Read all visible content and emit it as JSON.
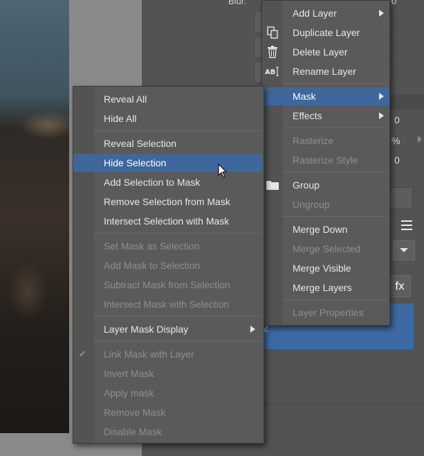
{
  "panel": {
    "blur_label": "Blur:",
    "blur_value": "0",
    "values": [
      "0",
      "%",
      "0"
    ],
    "layer_partial_text": "2",
    "fx_label": "fx"
  },
  "layer_menu": {
    "items": [
      {
        "label": "Add Layer",
        "enabled": true,
        "submenu": true,
        "icon": null
      },
      {
        "label": "Duplicate Layer",
        "enabled": true,
        "submenu": false,
        "icon": "duplicate-icon"
      },
      {
        "label": "Delete Layer",
        "enabled": true,
        "submenu": false,
        "icon": "trash-icon"
      },
      {
        "label": "Rename Layer",
        "enabled": true,
        "submenu": false,
        "icon": "rename-icon"
      },
      {
        "label": "Mask",
        "enabled": true,
        "submenu": true,
        "highlighted": true
      },
      {
        "label": "Effects",
        "enabled": true,
        "submenu": true
      },
      {
        "label": "Rasterize",
        "enabled": false
      },
      {
        "label": "Rasterize Style",
        "enabled": false
      },
      {
        "label": "Group",
        "enabled": true,
        "icon": "folder-icon"
      },
      {
        "label": "Ungroup",
        "enabled": false
      },
      {
        "label": "Merge Down",
        "enabled": true
      },
      {
        "label": "Merge Selected",
        "enabled": false
      },
      {
        "label": "Merge Visible",
        "enabled": true
      },
      {
        "label": "Merge Layers",
        "enabled": true
      },
      {
        "label": "Layer Properties",
        "enabled": false
      }
    ]
  },
  "mask_menu": {
    "items": [
      {
        "label": "Reveal All",
        "enabled": true
      },
      {
        "label": "Hide All",
        "enabled": true
      },
      {
        "label": "Reveal Selection",
        "enabled": true
      },
      {
        "label": "Hide Selection",
        "enabled": true,
        "highlighted": true
      },
      {
        "label": "Add Selection to Mask",
        "enabled": true
      },
      {
        "label": "Remove Selection from Mask",
        "enabled": true
      },
      {
        "label": "Intersect Selection with Mask",
        "enabled": true
      },
      {
        "label": "Set Mask as Selection",
        "enabled": false
      },
      {
        "label": "Add Mask to Selection",
        "enabled": false
      },
      {
        "label": "Subtract Mask from Selection",
        "enabled": false
      },
      {
        "label": "Intersect Mask with Selection",
        "enabled": false
      },
      {
        "label": "Layer Mask Display",
        "enabled": true,
        "submenu": true
      },
      {
        "label": "Link Mask with Layer",
        "enabled": false,
        "checked": true
      },
      {
        "label": "Invert Mask",
        "enabled": false
      },
      {
        "label": "Apply mask",
        "enabled": false
      },
      {
        "label": "Remove Mask",
        "enabled": false
      },
      {
        "label": "Disable Mask",
        "enabled": false
      }
    ]
  },
  "colors": {
    "highlight": "#3f679b",
    "menu_bg": "#5a5a5a",
    "disabled_text": "#8f8f8f"
  }
}
